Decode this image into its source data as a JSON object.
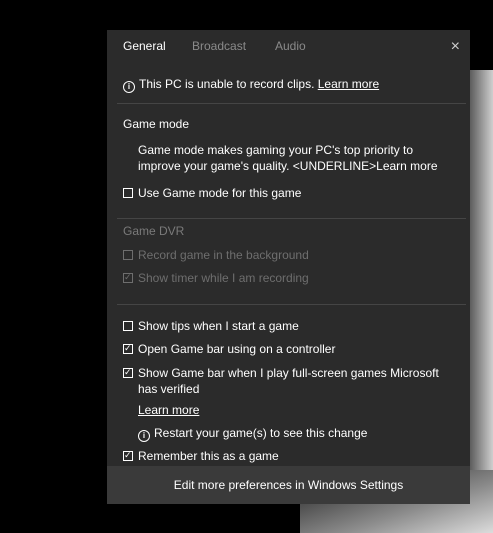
{
  "tabs": [
    {
      "label": "General"
    },
    {
      "label": "Broadcast"
    },
    {
      "label": "Audio"
    }
  ],
  "close_glyph": "×",
  "info_icon": "i",
  "notice": {
    "text": "This PC is unable to record clips.",
    "link": "Learn more"
  },
  "game_mode": {
    "title": "Game mode",
    "description": "Game mode makes gaming your PC's top priority to improve your game's quality. <UNDERLINE>Learn more",
    "checkbox_label": "Use Game mode for this game"
  },
  "game_dvr": {
    "title": "Game DVR",
    "record_label": "Record game in the background",
    "timer_label": "Show timer while I am recording"
  },
  "options": {
    "tips_label": "Show tips when I start a game",
    "controller_label": "Open Game bar using  on a controller",
    "fullscreen_label": "Show Game bar when I play full-screen games Microsoft has verified",
    "learn_more": "Learn more",
    "restart_note": "Restart your game(s) to see this change",
    "remember_label": "Remember this as a game"
  },
  "footer": {
    "label": "Edit more preferences in Windows Settings"
  },
  "checkmark": "✓",
  "colors": {
    "panel": "#2b2b2b",
    "footer": "#3a3a3a",
    "dim_text": "#7a7a7a"
  }
}
